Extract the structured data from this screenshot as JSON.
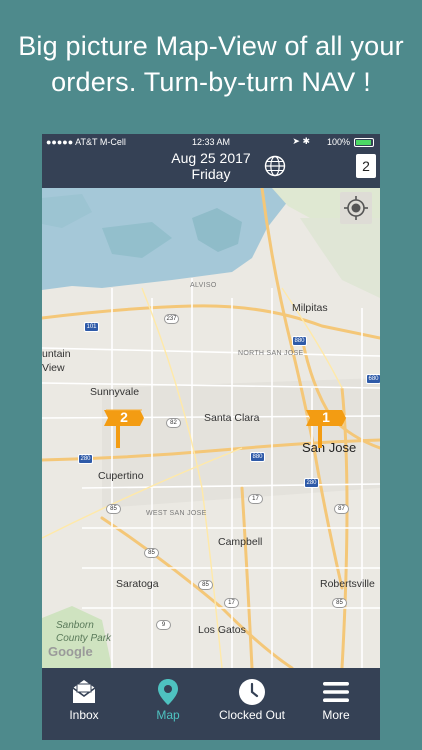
{
  "caption": {
    "line1": "Big picture Map-View of all your",
    "line2": "orders. Turn-by-turn NAV !"
  },
  "status_bar": {
    "carrier": "●●●●● AT&T M-Cell",
    "time": "12:33 AM",
    "battery": "100%"
  },
  "header": {
    "date": "Aug 25 2017",
    "day": "Friday",
    "order_count": "2",
    "globe_icon": "globe-icon"
  },
  "map": {
    "labels": {
      "alviso": "ALVISO",
      "milpitas": "Milpitas",
      "north_san_jose": "NORTH SAN JOSE",
      "mountain_view_1": "untain",
      "mountain_view_2": "View",
      "sunnyvale": "Sunnyvale",
      "santa_clara": "Santa Clara",
      "san_jose": "San Jose",
      "cupertino": "Cupertino",
      "west_san_jose": "WEST SAN JOSE",
      "campbell": "Campbell",
      "saratoga": "Saratoga",
      "robertsville": "Robertsville",
      "los_gatos": "Los Gatos",
      "park_1": "Sanborn",
      "park_2": "County Park",
      "google": "Google"
    },
    "shields": {
      "s101": "101",
      "s237": "237",
      "s880a": "880",
      "s680": "680",
      "s82": "82",
      "s280a": "280",
      "s880b": "880",
      "s280b": "280",
      "s85a": "85",
      "s87": "87",
      "s17a": "17",
      "s85b": "85",
      "s85c": "85",
      "s17b": "17",
      "s85d": "85",
      "s9": "9"
    },
    "markers": [
      {
        "label": "2"
      },
      {
        "label": "1"
      }
    ],
    "marker_color": "#f39c12",
    "locate_icon": "crosshair-icon"
  },
  "tabs": [
    {
      "label": "Inbox",
      "icon": "inbox-icon"
    },
    {
      "label": "Map",
      "icon": "map-pin-icon"
    },
    {
      "label": "Clocked Out",
      "icon": "clock-icon"
    },
    {
      "label": "More",
      "icon": "menu-icon"
    }
  ],
  "colors": {
    "background": "#4e8a8c",
    "bar": "#354155",
    "active_tab": "#4ec2c0",
    "water": "#a5c8d8"
  }
}
